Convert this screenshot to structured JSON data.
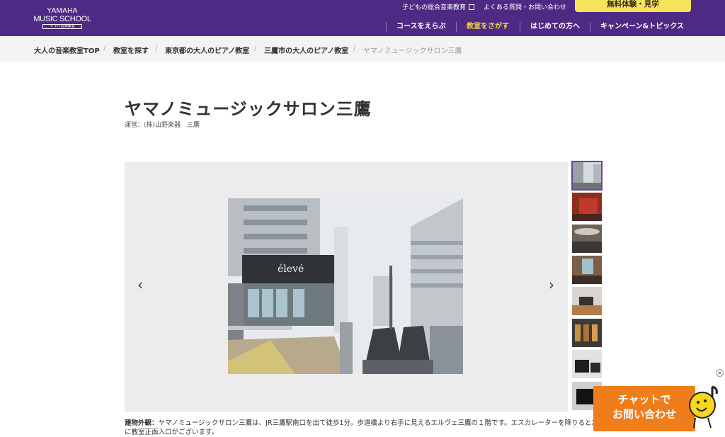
{
  "header": {
    "logo_line1": "YAMAHA",
    "logo_line2": "MUSIC SCHOOL",
    "logo_line3": "ヤマハ音楽教室",
    "util_kids": "子どもの総合音楽教育",
    "util_faq": "よくある質問・お問い合わせ",
    "trial_button": "無料体験・見学",
    "nav": [
      "コースをえらぶ",
      "教室をさがす",
      "はじめての方へ",
      "キャンペーン&トピックス"
    ]
  },
  "breadcrumb": {
    "items": [
      "大人の音楽教室TOP",
      "教室を探す",
      "東京都の大人のピアノ教室",
      "三鷹市の大人のピアノ教室"
    ],
    "current": "ヤマノミュージックサロン三鷹",
    "separator": "/"
  },
  "page": {
    "title": "ヤマノミュージックサロン三鷹",
    "operator": "運営：(株)山野楽器　三鷹"
  },
  "gallery": {
    "prev_icon": "chevron-left-icon",
    "next_icon": "chevron-right-icon",
    "prev_glyph": "‹",
    "next_glyph": "›",
    "active_index": 0,
    "thumbnail_count": 8,
    "caption_label": "建物外観：",
    "caption_text": "ヤマノミュージックサロン三鷹は、JR三鷹駅南口を出て徒歩1分。歩道橋より右手に見えるエルヴェ三鷹の１階です。エスカレーターを降りると左手に教室正面入口がございます。",
    "sign_text": "élevé"
  },
  "chat": {
    "line1": "チャットで",
    "line2": "お問い合わせ",
    "close": "×"
  },
  "colors": {
    "header_bg": "#4f2a84",
    "accent_yellow": "#f7e35b",
    "active_nav": "#f3d34a",
    "chat_orange": "#ef7d1a"
  }
}
